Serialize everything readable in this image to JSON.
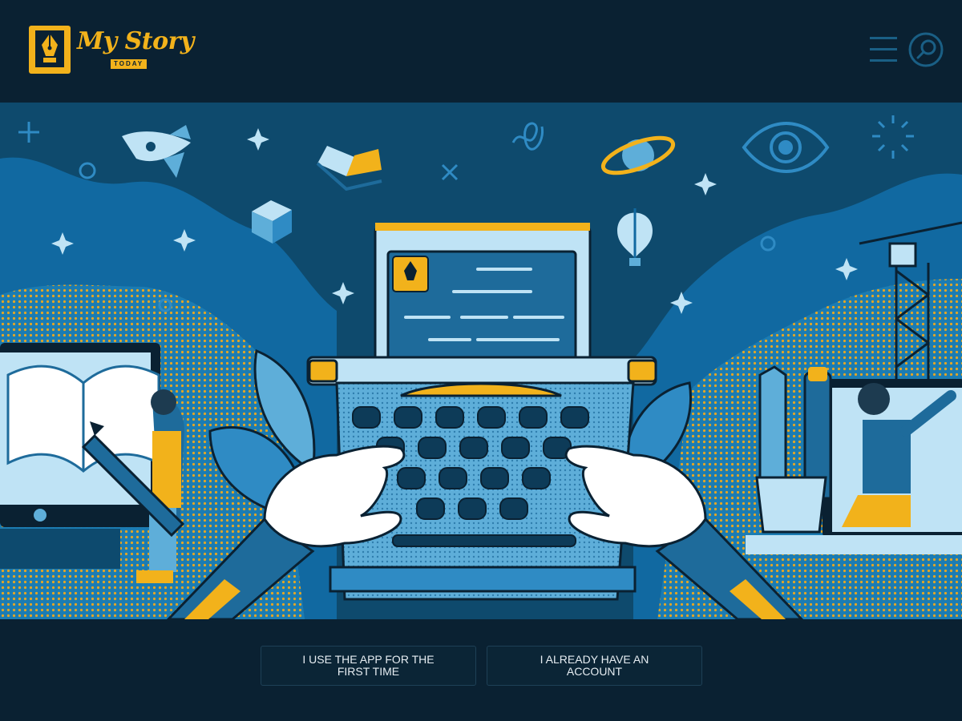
{
  "app": {
    "logo_text": "My Story",
    "logo_subtext": "TODAY"
  },
  "header": {
    "icons": [
      "hamburger-menu-icon",
      "search-icon"
    ]
  },
  "hero": {
    "illustration": "typewriter-hands-illustration"
  },
  "actions": {
    "first_time_label": "I USE THE APP FOR THE FIRST TIME",
    "existing_account_label": "I ALREADY HAVE AN ACCOUNT"
  },
  "colors": {
    "background": "#0a2132",
    "accent": "#f2b21b",
    "primary_blue": "#1a7ab0",
    "light_blue": "#bfe3f5"
  }
}
